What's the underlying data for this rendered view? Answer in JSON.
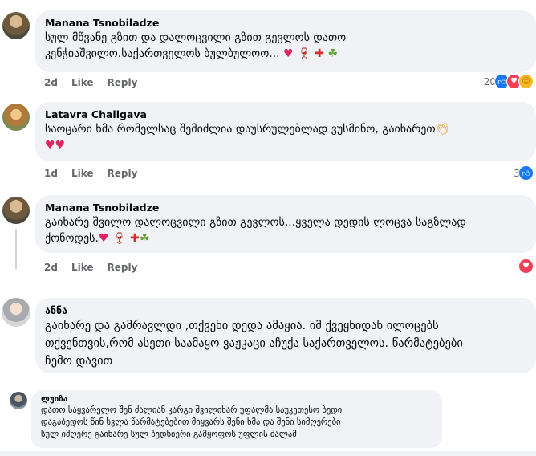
{
  "comments": [
    {
      "author": "Manana Tsnobiladze",
      "line1": "სულ მწვანე გზით და დალოცვილი გზით გევლოს დათო",
      "line2": "კენჭიაშვილო.საქართველოს ბულბულოო...",
      "emojis": [
        "red-heart",
        "wine-glass",
        "georgian-flag",
        "clover"
      ],
      "time": "2d",
      "like_label": "Like",
      "reply_label": "Reply",
      "reaction_count": "20",
      "reaction_icons": [
        "like",
        "love",
        "care"
      ]
    },
    {
      "author": "Latavra Chaligava",
      "line1": "საოცარი ხმა რომელსაც შემიძლია დაუსრულებლად ვუსმინო, გაიხარეთ",
      "line2": "",
      "emojis": [
        "clapping-hands",
        "red-heart",
        "red-heart"
      ],
      "time": "1d",
      "like_label": "Like",
      "reply_label": "Reply",
      "reaction_count": "3",
      "reaction_icons": [
        "like"
      ]
    },
    {
      "author": "Manana Tsnobiladze",
      "line1": "გაიხარე შვილო დალოცვილი გზით გევლოს...ყველა დედის ლოცვა საგზლად",
      "line2": "ქონოდეს.",
      "emojis": [
        "red-heart",
        "wine-glass",
        "georgian-flag",
        "clover"
      ],
      "time": "2d",
      "like_label": "Like",
      "reply_label": "Reply",
      "reaction_count": "",
      "reaction_icons": [
        "love"
      ]
    },
    {
      "author": "ანნა",
      "line1": "გაიხარე და გამრავლდი ,თქვენი დედა ამაყია. იმ ქვეყნიდან ილოცებს",
      "line2": "თქვენთვის,რომ ასეთი საამაყო ვაჟკაცი აჩუქა საქართველოს. წარმატებები",
      "line3": "ჩემო დავით"
    },
    {
      "author": "ლუიზა",
      "line1": "დათო საყვარელო შენ ძალიან კარგი შვილიხარ უფალმა საუკეთესო ბედი",
      "line2": "დაგაბედოს წინ სვლა წარმატებებით მიყვარს შენი ხმა და შენი სიმღერები",
      "line3": "სულ იმღერე გაიხარე სულ ბედნიერი გამყოფოს უფლის ძალამ"
    }
  ],
  "colors": {
    "bubble": "#f0f2f5",
    "meta": "#65676b",
    "like_blue": "#1877f2",
    "love_red": "#f33e58"
  }
}
